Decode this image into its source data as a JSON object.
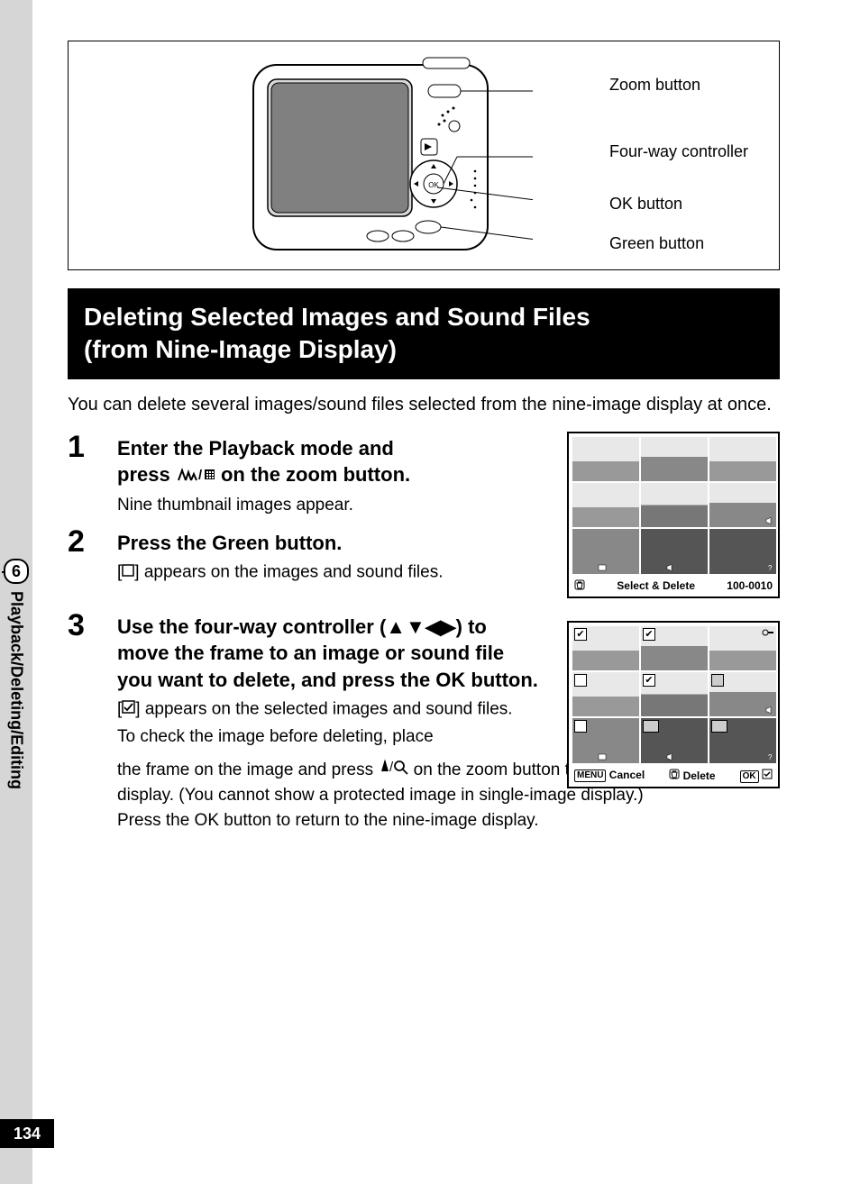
{
  "side": {
    "chapter_number": "6",
    "chapter_title": "Playback/Deleting/Editing",
    "page_number": "134"
  },
  "camera_callouts": {
    "zoom": "Zoom button",
    "fourway": "Four-way controller",
    "ok": "OK button",
    "green": "Green button"
  },
  "section_title_l1": "Deleting Selected Images and Sound Files",
  "section_title_l2": "(from Nine-Image Display)",
  "intro": "You can delete several images/sound files selected from the nine-image display at once.",
  "steps": {
    "1": {
      "num": "1",
      "title_a": "Enter the Playback mode and",
      "title_b": "press ",
      "title_c": " on the zoom button.",
      "desc": "Nine thumbnail images appear."
    },
    "2": {
      "num": "2",
      "title": "Press the Green button.",
      "desc_a": "[",
      "desc_b": "] appears on the images and sound files."
    },
    "3": {
      "num": "3",
      "title": "Use the four-way controller (▲▼◀▶) to move the frame to an image or sound file you want to delete, and press the OK button.",
      "desc_a": "[",
      "desc_b": "] appears on the selected images and sound files.",
      "desc_c": "To check the image before deleting, place",
      "desc_d": "the frame on the image and press ",
      "desc_e": " on the zoom button to show it in single-image display. (You cannot show a protected image in single-image display.)",
      "desc_f": "Press the OK button to return to the nine-image display."
    }
  },
  "screen1": {
    "label": "Select & Delete",
    "file_no": "100-0010"
  },
  "screen2": {
    "menu": "MENU",
    "cancel": "Cancel",
    "delete": "Delete",
    "ok": "OK"
  }
}
